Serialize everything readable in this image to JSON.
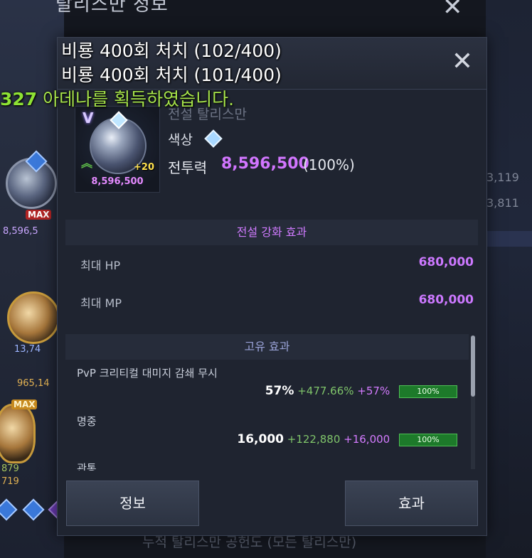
{
  "background": {
    "title": "탈리스만 정보",
    "bottom_text": "누적 탈리스만 공헌도 (모든 탈리스만)",
    "right_values": [
      "3,119",
      "3,811"
    ],
    "left_values": [
      "8,596,5",
      "13,74",
      "965,14",
      "879",
      "719"
    ]
  },
  "notifications": {
    "line1": "비룡 400회 처치 (102/400)",
    "line2": "비룡 400회 처치 (101/400)",
    "line3_number": "327",
    "line3_text": "아데나를 획득하였습니다."
  },
  "item": {
    "name": "전설 탈리스만",
    "color_label": "색상",
    "combat_power_label": "전투력",
    "combat_power_value": "8,596,500",
    "combat_power_pct": "(100%)",
    "enhance": "+20",
    "icon_cp": "8,596,500",
    "grade_letter": "V"
  },
  "legend_effect": {
    "title": "전설 강화 효과",
    "stats": [
      {
        "label": "최대 HP",
        "value": "680,000"
      },
      {
        "label": "최대 MP",
        "value": "680,000"
      }
    ]
  },
  "unique_effect": {
    "title": "고유 효과",
    "stats": [
      {
        "label": "PvP 크리티컬 대미지 감쇄 무시",
        "base": "57%",
        "add1": "+477.66%",
        "add2": "+57%",
        "bar": "100%"
      },
      {
        "label": "명중",
        "base": "16,000",
        "add1": "+122,880",
        "add2": "+16,000",
        "bar": "100%"
      },
      {
        "label": "관통"
      }
    ]
  },
  "buttons": {
    "info": "정보",
    "effect": "효과",
    "close": "✕"
  },
  "colors": {
    "accent_purple": "#cc78ff",
    "positive_green": "#7fc46a",
    "bar_green": "#1d7a2a"
  }
}
